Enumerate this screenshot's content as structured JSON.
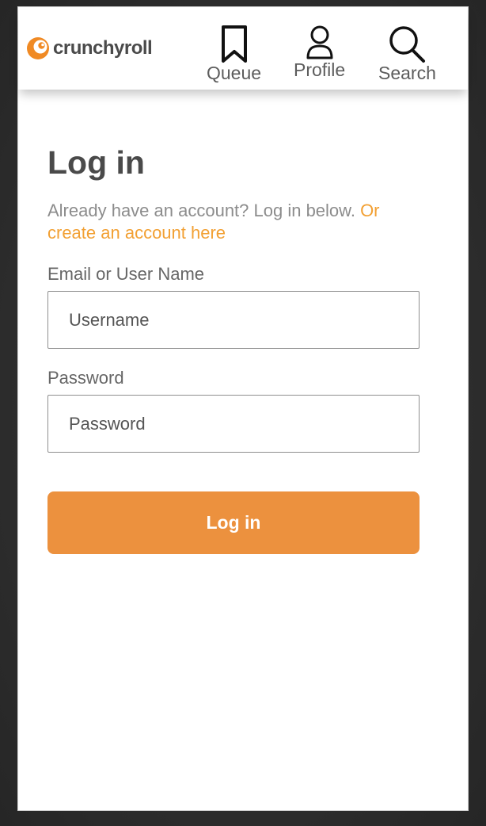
{
  "header": {
    "brand": "crunchyroll",
    "nav": [
      {
        "label": "Queue",
        "icon": "bookmark-icon"
      },
      {
        "label": "Profile",
        "icon": "user-icon"
      },
      {
        "label": "Search",
        "icon": "search-icon"
      }
    ]
  },
  "login": {
    "title": "Log in",
    "intro_text": "Already have an account? Log in below. ",
    "create_link": "Or create an account here",
    "email_label": "Email or User Name",
    "username_placeholder": "Username",
    "password_label": "Password",
    "password_placeholder": "Password",
    "submit_label": "Log in"
  },
  "colors": {
    "accent": "#f2a033",
    "button": "#ec913e",
    "text_dark": "#4a4a4a"
  }
}
